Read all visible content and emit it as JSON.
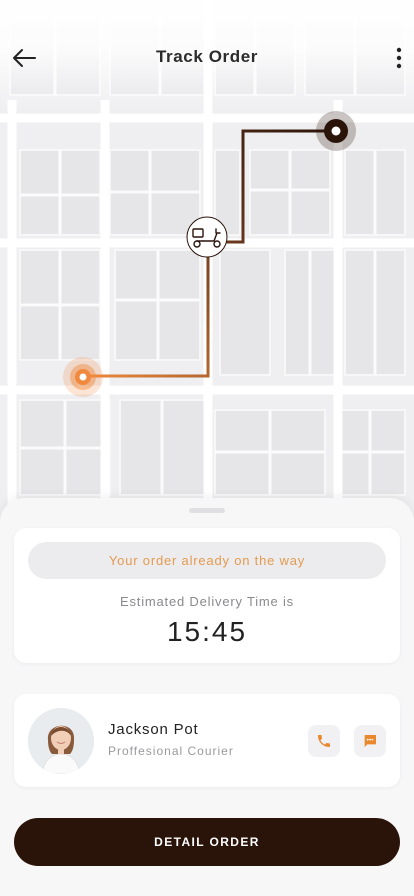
{
  "header": {
    "title": "Track Order",
    "back_icon": "arrow-left-icon",
    "menu_icon": "more-vertical-icon"
  },
  "map": {
    "origin_marker_color": "#f0893d",
    "destination_marker_color": "#2a140a",
    "courier_icon": "scooter-icon"
  },
  "status": {
    "message": "Your order already on the way",
    "eta_label": "Estimated Delivery Time is",
    "eta_time": "15:45"
  },
  "courier": {
    "name": "Jackson Pot",
    "role": "Proffesional Courier",
    "call_icon": "phone-icon",
    "chat_icon": "chat-icon"
  },
  "actions": {
    "detail_order": "DETAIL ORDER"
  },
  "colors": {
    "accent": "#e49a4f",
    "primary_dark": "#2a140a"
  }
}
